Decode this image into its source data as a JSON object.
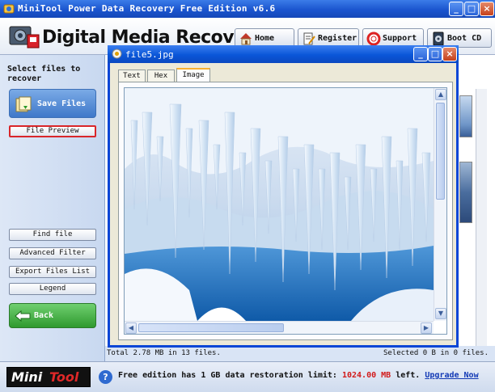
{
  "app": {
    "title": "MiniTool Power Data Recovery Free Edition v6.6",
    "brand": "Digital Media Recovery"
  },
  "nav": [
    {
      "label": "Home",
      "icon": "home-icon"
    },
    {
      "label": "Register",
      "icon": "register-icon"
    },
    {
      "label": "Support",
      "icon": "support-icon"
    },
    {
      "label": "Boot CD",
      "icon": "boot-cd-icon"
    }
  ],
  "sidebar": {
    "heading": "Select files to recover",
    "save_files": "Save Files",
    "file_preview": "File Preview",
    "find_file": "Find file",
    "advanced_filter": "Advanced Filter",
    "export_files_list": "Export Files List",
    "legend": "Legend",
    "back": "Back"
  },
  "dialog": {
    "title": "file5.jpg",
    "tabs": [
      "Text",
      "Hex",
      "Image"
    ],
    "active_tab": "Image"
  },
  "status": {
    "total": "Total 2.78 MB in 13 files.",
    "selected": "Selected 0 B in 0 files."
  },
  "footer": {
    "logo_part1": "Mini",
    "logo_part2": "Tool",
    "limit_prefix": "Free edition has 1 GB data restoration limit:",
    "limit_value": "1024.00 MB",
    "limit_suffix": "left.",
    "upgrade_link": "Upgrade Now"
  },
  "colors": {
    "titlebar": "#1b55cf",
    "sidebar": "#c8d8f0",
    "accent_red": "#d21a1a",
    "link_blue": "#1239b5",
    "save_button": "#3f78c9",
    "back_button": "#2f9a2f"
  }
}
